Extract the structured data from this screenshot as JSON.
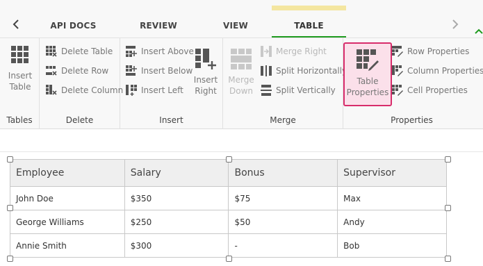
{
  "tabs": {
    "items": [
      "API DOCS",
      "REVIEW",
      "VIEW",
      "TABLE"
    ],
    "active": "TABLE",
    "active_color": "#1f9b1f"
  },
  "ribbon": {
    "groups": {
      "tables": {
        "label": "Tables",
        "insert_table": [
          "Insert",
          "Table"
        ]
      },
      "delete": {
        "label": "Delete",
        "delete_table": "Delete Table",
        "delete_row": "Delete Row",
        "delete_column": "Delete Column"
      },
      "insert": {
        "label": "Insert",
        "insert_above": "Insert Above",
        "insert_below": "Insert Below",
        "insert_left": "Insert Left",
        "insert_right": [
          "Insert",
          "Right"
        ]
      },
      "merge": {
        "label": "Merge",
        "merge_down": [
          "Merge",
          "Down"
        ],
        "merge_right": "Merge Right",
        "split_horizontally": "Split Horizontally",
        "split_vertically": "Split Vertically"
      },
      "properties": {
        "label": "Properties",
        "table_properties": [
          "Table",
          "Properties"
        ],
        "row_properties": "Row Properties",
        "column_properties": "Column Properties",
        "cell_properties": "Cell Properties",
        "highlight_color": "#d82c6b"
      }
    }
  },
  "table": {
    "headers": [
      "Employee",
      "Salary",
      "Bonus",
      "Supervisor"
    ],
    "rows": [
      [
        "John Doe",
        "$350",
        "$75",
        "Max"
      ],
      [
        "George Williams",
        "$250",
        "$50",
        "Andy"
      ],
      [
        "Annie Smith",
        "$300",
        "-",
        "Bob"
      ]
    ]
  }
}
